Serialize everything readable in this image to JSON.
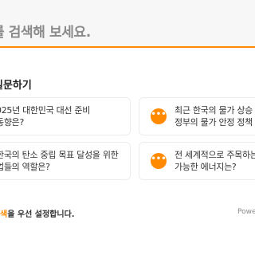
{
  "search": {
    "placeholder_text": "를 검색해 보세요."
  },
  "section": {
    "title": "질문하기"
  },
  "questions": [
    {
      "text": "025년 대한민국 대선 준비\n동향은?"
    },
    {
      "text": "최근 한국의 물가 상승\n정부의 물가 안정 정책"
    },
    {
      "text": "한국의 탄소 중립 목표 달성을 위한\n업들의 역할은?"
    },
    {
      "text": "전 세계적으로 주목하는\n가능한 에너지는?"
    }
  ],
  "footer": {
    "accent_text": "색",
    "rest_text": "을 우선 설정합니다.",
    "powered_by": "Powe"
  },
  "colors": {
    "accent": "#ff8a00",
    "search_bg": "#f7f7f7"
  },
  "icons": {
    "question_icon": "chat-bubble-icon"
  }
}
